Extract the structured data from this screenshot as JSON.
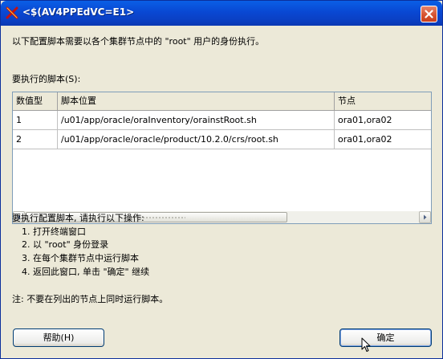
{
  "window": {
    "title": "<$(AV4PPEdVC=E1>"
  },
  "intro": "以下配置脚本需要以各个集群节点中的 \"root\" 用户的身份执行。",
  "scripts_label": "要执行的脚本(S):",
  "table": {
    "headers": [
      "数值型",
      "脚本位置",
      "节点"
    ],
    "rows": [
      [
        "1",
        "/u01/app/oracle/oraInventory/orainstRoot.sh",
        "ora01,ora02"
      ],
      [
        "2",
        "/u01/app/oracle/oracle/product/10.2.0/crs/root.sh",
        "ora01,ora02"
      ]
    ]
  },
  "instructions": {
    "heading": "要执行配置脚本, 请执行以下操作:",
    "steps": [
      "1. 打开终端窗口",
      "2. 以 \"root\" 身份登录",
      "3. 在每个集群节点中运行脚本",
      "4. 返回此窗口, 单击 \"确定\" 继续"
    ]
  },
  "note": "注: 不要在列出的节点上同时运行脚本。",
  "buttons": {
    "help": "帮助(H)",
    "ok": "确定"
  },
  "icons": {
    "app": "oracle-installer-x-icon",
    "close": "close-icon"
  },
  "colors": {
    "titlebar": "#0a5fe6",
    "close": "#d6502d",
    "dialog_bg": "#ece9d8"
  }
}
